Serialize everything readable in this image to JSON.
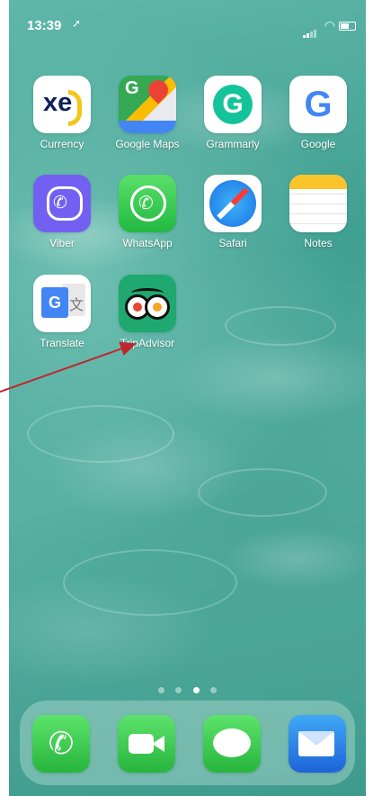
{
  "status_bar": {
    "time": "13:39",
    "location_icon": "location-arrow-icon",
    "signal_icon": "signal-icon",
    "wifi_icon": "wifi-icon",
    "battery_icon": "battery-icon"
  },
  "apps": [
    {
      "name": "currency",
      "label": "Currency",
      "icon": "xe-icon",
      "glyph": "xe"
    },
    {
      "name": "google-maps",
      "label": "Google Maps",
      "icon": "map-pin-icon",
      "glyph": "G"
    },
    {
      "name": "grammarly",
      "label": "Grammarly",
      "icon": "grammarly-g-icon",
      "glyph": "G"
    },
    {
      "name": "google",
      "label": "Google",
      "icon": "google-g-icon",
      "glyph": "G"
    },
    {
      "name": "viber",
      "label": "Viber",
      "icon": "phone-bubble-icon"
    },
    {
      "name": "whatsapp",
      "label": "WhatsApp",
      "icon": "phone-bubble-icon"
    },
    {
      "name": "safari",
      "label": "Safari",
      "icon": "compass-icon"
    },
    {
      "name": "notes",
      "label": "Notes",
      "icon": "notepad-icon"
    },
    {
      "name": "translate",
      "label": "Translate",
      "icon": "translate-icon",
      "glyph": "G"
    },
    {
      "name": "tripadvisor",
      "label": "TripAdvisor",
      "icon": "owl-eyes-icon"
    }
  ],
  "dock": [
    {
      "name": "phone",
      "icon": "phone-icon"
    },
    {
      "name": "facetime",
      "icon": "video-camera-icon"
    },
    {
      "name": "messages",
      "icon": "speech-bubble-icon"
    },
    {
      "name": "mail",
      "icon": "envelope-icon"
    }
  ],
  "page_dots": {
    "count": 4,
    "active_index": 2
  },
  "colors": {
    "annotation_arrow": "#c0262d"
  }
}
